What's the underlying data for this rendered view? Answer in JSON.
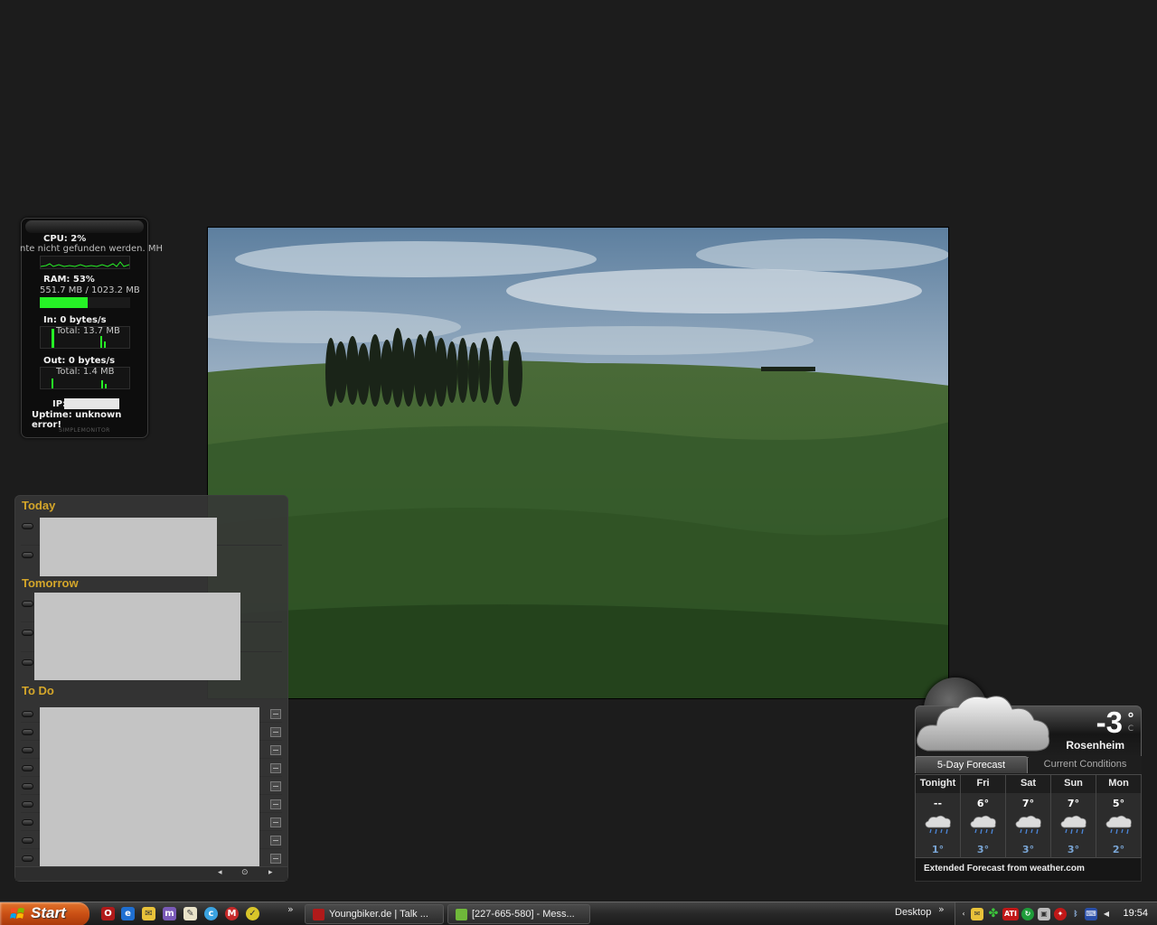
{
  "sysmon": {
    "cpu_label": "CPU: 2%",
    "error_text": "nte nicht gefunden werden. MH",
    "ram_label": "RAM: 53%",
    "ram_detail": "551.7 MB / 1023.2 MB",
    "ram_fraction": 0.53,
    "in_label": "In: 0 bytes/s",
    "in_total": "Total: 13.7 MB",
    "out_label": "Out: 0 bytes/s",
    "out_total": "Total: 1.4 MB",
    "ip_label": "IP:",
    "uptime": "Uptime: unknown error!",
    "brand": "SIMPLEMONITOR",
    "graph_color": "#26f226"
  },
  "calendar": {
    "today": "Today",
    "tomorrow": "Tomorrow",
    "todo": "To Do",
    "accent": "#d4a62a"
  },
  "weather": {
    "temperature": "-3",
    "degree": "°",
    "unit": "C",
    "city": "Rosenheim",
    "tab_forecast": "5-Day Forecast",
    "tab_current": "Current Conditions",
    "days": [
      {
        "day": "Tonight",
        "high": "--",
        "low": "1°",
        "icon": "rain-cloud-icon"
      },
      {
        "day": "Fri",
        "high": "6°",
        "low": "3°",
        "icon": "rain-cloud-icon"
      },
      {
        "day": "Sat",
        "high": "7°",
        "low": "3°",
        "icon": "rain-cloud-icon"
      },
      {
        "day": "Sun",
        "high": "7°",
        "low": "3°",
        "icon": "rain-cloud-icon"
      },
      {
        "day": "Mon",
        "high": "5°",
        "low": "2°",
        "icon": "rain-cloud-icon"
      }
    ],
    "extended": "Extended Forecast from weather.com"
  },
  "taskbar": {
    "start_label": "Start",
    "chevron": "»",
    "tasks": [
      {
        "label": "Youngbiker.de | Talk ...",
        "icon": "opera-icon"
      },
      {
        "label": "[227-665-580] - Mess...",
        "icon": "messenger-icon"
      }
    ],
    "desktop_label": "Desktop",
    "clock": "19:54"
  }
}
